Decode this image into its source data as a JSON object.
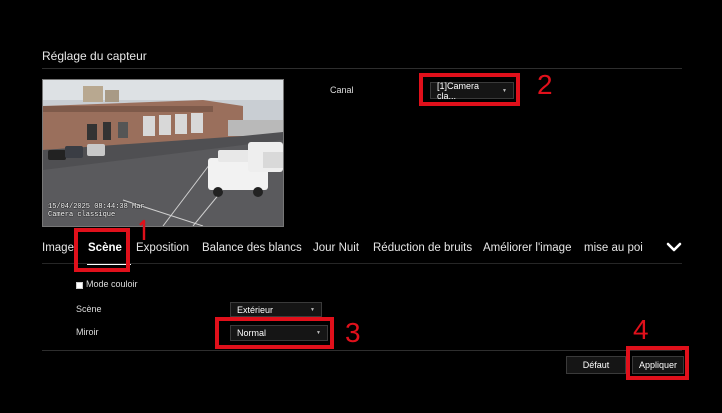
{
  "page": {
    "title": "Réglage du capteur"
  },
  "preview": {
    "timestamp": "15/04/2025 08:44:38 Mar",
    "camera_name": "Camera classique"
  },
  "channel": {
    "label": "Canal",
    "value": "[1]Camera cla..."
  },
  "tabs": [
    {
      "label": "Image",
      "active": false
    },
    {
      "label": "Scène",
      "active": true
    },
    {
      "label": "Exposition",
      "active": false
    },
    {
      "label": "Balance des blancs",
      "active": false
    },
    {
      "label": "Jour Nuit",
      "active": false
    },
    {
      "label": "Réduction de bruits",
      "active": false
    },
    {
      "label": "Améliorer l'image",
      "active": false
    },
    {
      "label": "mise au poi",
      "active": false
    }
  ],
  "settings": {
    "corridor_mode": {
      "label": "Mode couloir",
      "checked": false
    },
    "scene": {
      "label": "Scène",
      "value": "Extérieur"
    },
    "mirror": {
      "label": "Miroir",
      "value": "Normal"
    }
  },
  "buttons": {
    "default": "Défaut",
    "apply": "Appliquer"
  },
  "annotations": {
    "n1": "1",
    "n2": "2",
    "n3": "3",
    "n4": "4"
  },
  "colors": {
    "highlight": "#e0101b",
    "background": "#000000"
  }
}
